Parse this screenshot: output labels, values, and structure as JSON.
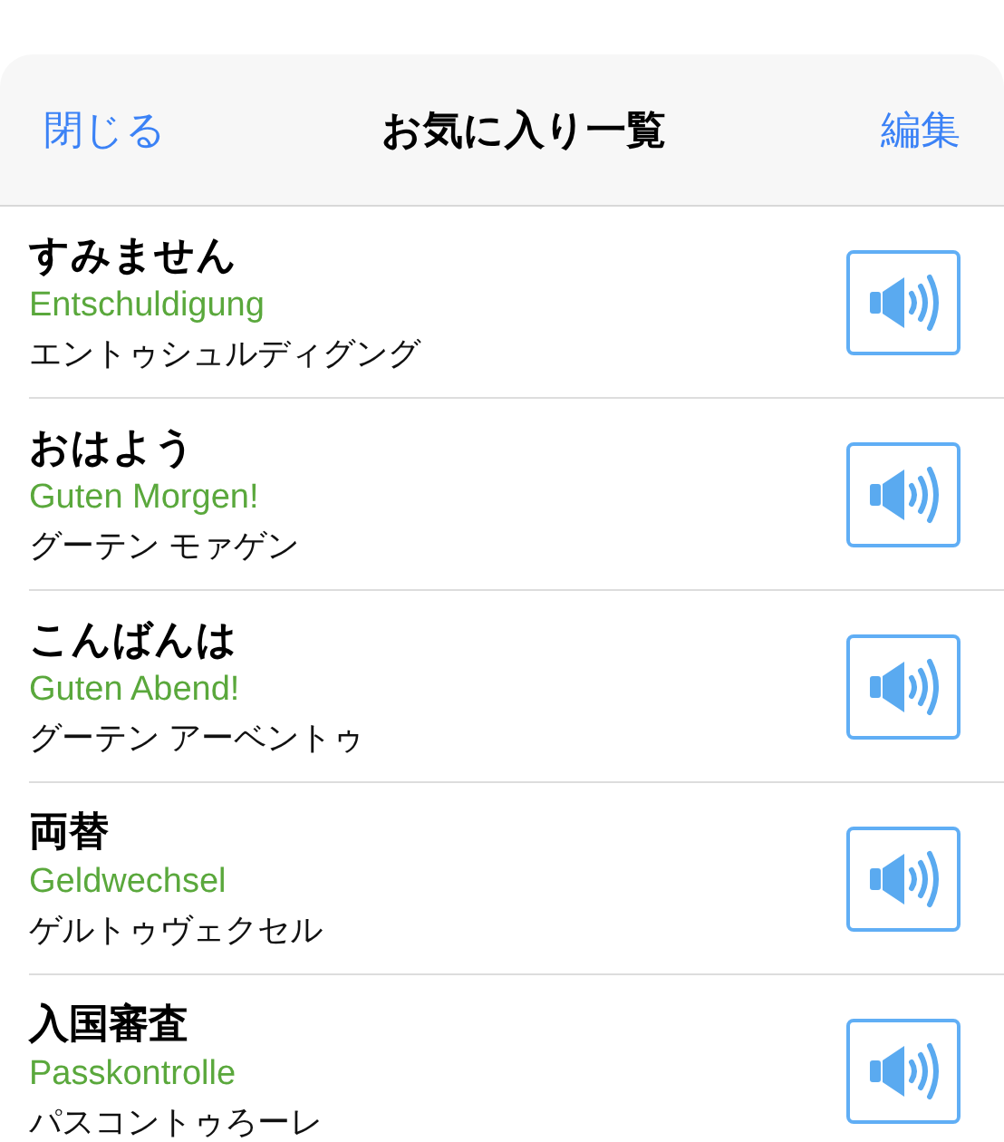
{
  "header": {
    "close": "閉じる",
    "title": "お気に入り一覧",
    "edit": "編集"
  },
  "items": [
    {
      "japanese": "すみません",
      "german": "Entschuldigung",
      "reading": "エントゥシュルディグング"
    },
    {
      "japanese": "おはよう",
      "german": "Guten Morgen!",
      "reading": "グーテン モァゲン"
    },
    {
      "japanese": "こんばんは",
      "german": "Guten Abend!",
      "reading": "グーテン アーベントゥ"
    },
    {
      "japanese": "両替",
      "german": "Geldwechsel",
      "reading": "ゲルトゥヴェクセル"
    },
    {
      "japanese": "入国審査",
      "german": "Passkontrolle",
      "reading": "パスコントゥろーレ"
    }
  ]
}
